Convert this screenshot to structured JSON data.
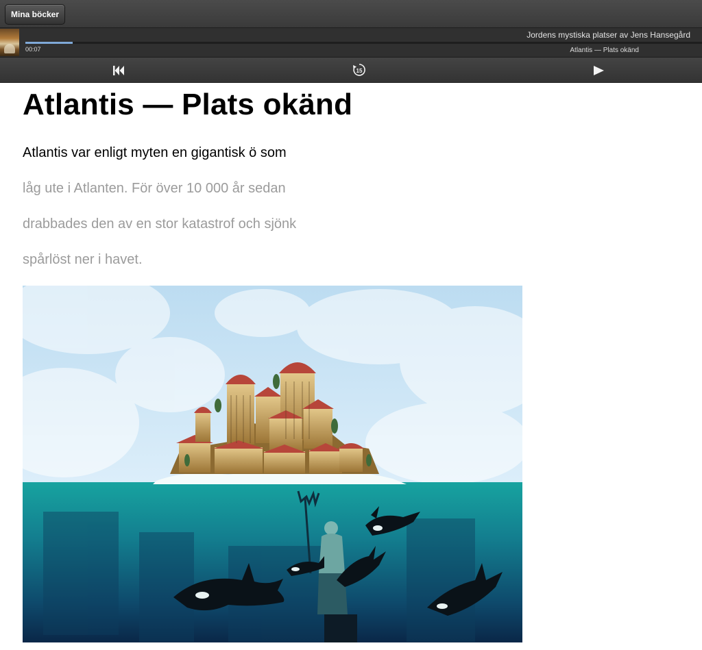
{
  "header": {
    "books_button_label": "Mina böcker"
  },
  "player": {
    "book_title": "Jordens mystiska platser av Jens Hansegård",
    "elapsed_time": "00:07",
    "chapter_title": "Atlantis — Plats okänd",
    "progress_fraction": 0.07
  },
  "controls": {
    "previous_icon": "skip-back-icon",
    "rewind_icon": "rewind-15-icon",
    "rewind_label": "15",
    "play_icon": "play-icon"
  },
  "article": {
    "title": "Atlantis — Plats okänd",
    "lines": [
      "Atlantis var enligt myten en gigantisk ö som",
      "låg ute i Atlanten. För över 10 000 år sedan",
      "drabbades den av en stor katastrof och sjönk",
      "spårlöst ner i havet."
    ],
    "active_line_index": 0
  },
  "colors": {
    "sky": "#cfe6f5",
    "sea_top": "#16a0a0",
    "sea_bottom": "#0b2c52",
    "progress": "#7fa9d8",
    "active_text": "#000000",
    "inactive_text": "#9b9b9b"
  }
}
